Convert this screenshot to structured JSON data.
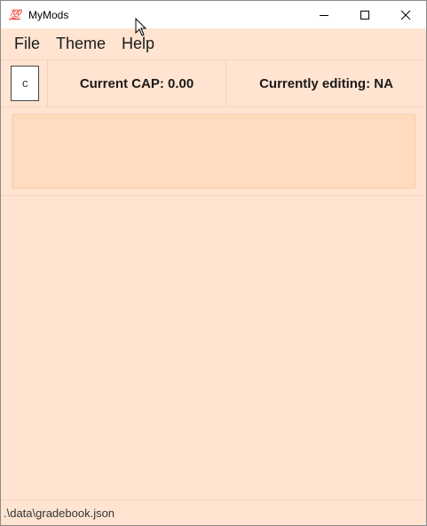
{
  "window": {
    "title": "MyMods",
    "app_icon_text": "💯",
    "controls": {
      "minimize": "minimize-icon",
      "maximize": "maximize-icon",
      "close": "close-icon"
    }
  },
  "menu": {
    "items": [
      {
        "label": "File"
      },
      {
        "label": "Theme"
      },
      {
        "label": "Help"
      }
    ]
  },
  "info_bar": {
    "command_input_value": "c",
    "current_cap": "Current CAP: 0.00",
    "currently_editing": "Currently editing: NA"
  },
  "status_bar": {
    "file_path": ".\\data\\gradebook.json"
  },
  "colors": {
    "background": "#ffe4d1",
    "result_box": "#ffdcc0",
    "title_bar": "#ffffff"
  }
}
